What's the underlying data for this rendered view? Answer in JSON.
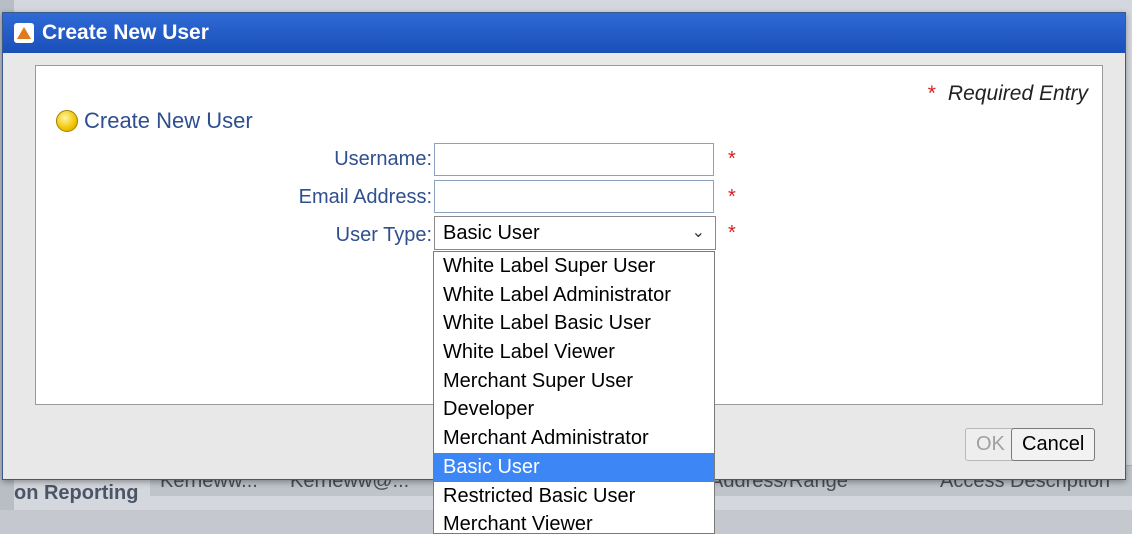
{
  "background": {
    "section_title": "on Reporting",
    "row_cells": [
      "Kerneww...",
      "Kerneww@...",
      "Address/Range",
      "Access Description"
    ]
  },
  "dialog": {
    "title": "Create New User",
    "required_note": "Required Entry",
    "required_marker": "*",
    "section_heading": "Create New User",
    "fields": {
      "username_label": "Username:",
      "username_value": "",
      "email_label": "Email Address:",
      "email_value": "",
      "user_type_label": "User Type:",
      "user_type_selected": "Basic User"
    },
    "user_type_options": [
      "White Label Super User",
      "White Label Administrator",
      "White Label Basic User",
      "White Label Viewer",
      "Merchant Super User",
      "Developer",
      "Merchant Administrator",
      "Basic User",
      "Restricted Basic User",
      "Merchant Viewer"
    ],
    "selected_index": 7,
    "buttons": {
      "ok": "OK",
      "cancel": "Cancel"
    }
  },
  "colors": {
    "titlebar": "#2f6ad6",
    "label_text": "#2f4f8f",
    "required_star": "#d61f1f",
    "highlight": "#3d86f5"
  },
  "icons": {
    "title": "app-logo-icon",
    "section": "bulb-icon",
    "select": "chevron-down-icon"
  }
}
